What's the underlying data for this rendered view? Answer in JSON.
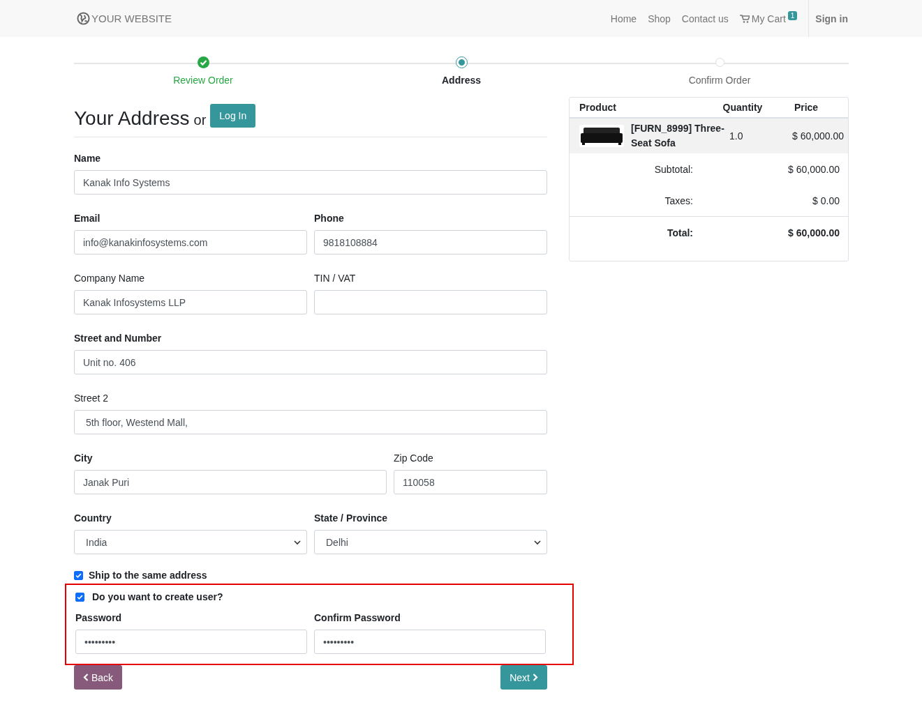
{
  "navbar": {
    "brand": "YOUR WEBSITE",
    "links": [
      {
        "label": "Home",
        "kind": "link"
      },
      {
        "label": "Shop",
        "kind": "link"
      },
      {
        "label": "Contact us",
        "kind": "link"
      },
      {
        "label": "My Cart",
        "kind": "cart",
        "badge": "1"
      }
    ],
    "sign_in": "Sign in"
  },
  "steps": [
    {
      "label": "Review Order",
      "done": true,
      "selected": false
    },
    {
      "label": "Address",
      "done": false,
      "selected": true
    },
    {
      "label": "Confirm Order",
      "done": false,
      "selected": false
    }
  ],
  "heading": {
    "title": "Your Address",
    "or": "or",
    "login_button": "Log In"
  },
  "form_rows": [
    [
      {
        "label": "Name",
        "required": true,
        "kind": "text",
        "value": "Kanak Info Systems"
      }
    ],
    [
      {
        "label": "Email",
        "required": true,
        "kind": "text",
        "value": "info@kanakinfosystems.com"
      },
      {
        "label": "Phone",
        "required": true,
        "kind": "text",
        "value": "9818108884"
      }
    ],
    [
      {
        "label": "Company Name",
        "required": false,
        "kind": "text",
        "value": "Kanak Infosystems LLP"
      },
      {
        "label": "TIN / VAT",
        "required": false,
        "kind": "text"
      }
    ],
    [
      {
        "label": "Street and Number",
        "required": true,
        "kind": "text",
        "value": "Unit no. 406"
      }
    ],
    [
      {
        "label": "Street 2",
        "required": false,
        "kind": "text",
        "value": " 5th floor, Westend Mall,"
      }
    ],
    [
      {
        "label": "City",
        "required": true,
        "kind": "text",
        "value": "Janak Puri"
      },
      {
        "label": "Zip Code",
        "required": false,
        "kind": "text",
        "value": "110058"
      }
    ],
    [
      {
        "label": "Country",
        "required": true,
        "kind": "select",
        "value": "India"
      },
      {
        "label": "State / Province",
        "required": true,
        "kind": "select",
        "value": "Delhi"
      }
    ]
  ],
  "ship_same": {
    "label": "Ship to the same address",
    "checked": true
  },
  "create_user": {
    "highlighted": true,
    "checkbox": {
      "label": "Do you want to create user?",
      "checked": true
    },
    "fields": [
      {
        "label": "Password",
        "required": true,
        "value": "•••••••••"
      },
      {
        "label": "Confirm Password",
        "required": true,
        "value": "•••••••••"
      }
    ]
  },
  "buttons": {
    "back": "Back",
    "next": "Next"
  },
  "summary": {
    "columns": [
      "Product",
      "Quantity",
      "Price"
    ],
    "rows": [
      {
        "product": "[FURN_8999] Three-Seat Sofa",
        "quantity": "1.0",
        "price": "$ 60,000.00"
      }
    ],
    "totals": [
      {
        "label": "Subtotal:",
        "value": "$ 60,000.00",
        "kind": "normal"
      },
      {
        "label": "Taxes:",
        "value": "$ 0.00",
        "kind": "normal"
      },
      {
        "label": "Total:",
        "value": "$ 60,000.00",
        "kind": "total"
      }
    ]
  }
}
